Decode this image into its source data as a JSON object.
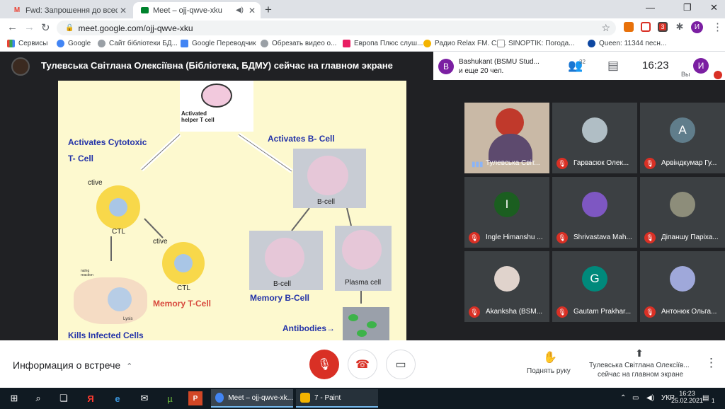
{
  "browser": {
    "tabs": [
      {
        "title": "Fwd: Запрошення до всесвітньо"
      },
      {
        "title": "Meet – ojj-qwve-xku"
      }
    ],
    "url": "meet.google.com/ojj-qwve-xku",
    "profile_initial": "И",
    "ext_badge": "3"
  },
  "bookmarks": [
    "Сервисы",
    "Google",
    "Сайт бібліотеки БД...",
    "Google Переводчик",
    "Обрезать видео о...",
    "Европа Плюс слуш...",
    "Радио Relax FM. Сл...",
    "SINOPTIK: Погода...",
    "Queen: 11344 песн..."
  ],
  "meet": {
    "presenter_title": "Тулевська Світлана Олексіївна (Бібліотека, БДМУ) сейчас на главном экране",
    "pinned_initial": "B",
    "pinned_line1": "Bashukant (BSMU Stud...",
    "pinned_line2": "и еще 20 чел.",
    "people_count": "32",
    "clock": "16:23",
    "me_initial": "И",
    "me_label": "Вы"
  },
  "slide": {
    "helper_label": "Activated\nhelper T cell",
    "activates_cytotoxic": "Activates  Cytotoxic",
    "t_cell": "T- Cell",
    "activates_b": "Activates B- Cell",
    "active1": "ctive",
    "active2": "ctive",
    "ctl1": "CTL",
    "ctl2": "CTL",
    "bcell1": "B-cell",
    "bcell2": "B-cell",
    "plasma": "Plasma cell",
    "memory_t": "Memory  T-Cell",
    "memory_b": "Memory B-Cell",
    "antibodies": "Antibodies→",
    "kills": "Kills Infected Cells",
    "lysis": "Lysis",
    "reaction": "nalng\nreaction"
  },
  "participants": [
    {
      "name": "Тулевська Світ...",
      "initial": "",
      "color": "#8d6e63",
      "muted": false
    },
    {
      "name": "Гарвасюк Олек...",
      "initial": "",
      "color": "#b0bec5",
      "muted": true
    },
    {
      "name": "Арвіндкумар Гу...",
      "initial": "A",
      "color": "#607d8b",
      "muted": true
    },
    {
      "name": "Ingle Himanshu ...",
      "initial": "I",
      "color": "#1b5e20",
      "muted": true
    },
    {
      "name": "Shrivastava Mah...",
      "initial": "",
      "color": "#7e57c2",
      "muted": true
    },
    {
      "name": "Діпаншу Паріха...",
      "initial": "",
      "color": "#8d8d7a",
      "muted": true
    },
    {
      "name": "Akanksha (BSM...",
      "initial": "",
      "color": "#e0d3cc",
      "muted": true
    },
    {
      "name": "Gautam Prakhar...",
      "initial": "G",
      "color": "#00897b",
      "muted": true
    },
    {
      "name": "Антонюк Ольга...",
      "initial": "",
      "color": "#9fa8da",
      "muted": true
    }
  ],
  "controls": {
    "info": "Информация о встрече",
    "raise_hand": "Поднять руку",
    "presenter_line1": "Тулевська Світлана Олексіїв...",
    "presenter_line2": "сейчас на главном экране"
  },
  "taskbar": {
    "app1": "Meet – ojj-qwve-xk...",
    "app2": "7 - Paint",
    "lang": "УКР",
    "time": "16:23",
    "date": "25.02.2021",
    "notif": "1"
  }
}
